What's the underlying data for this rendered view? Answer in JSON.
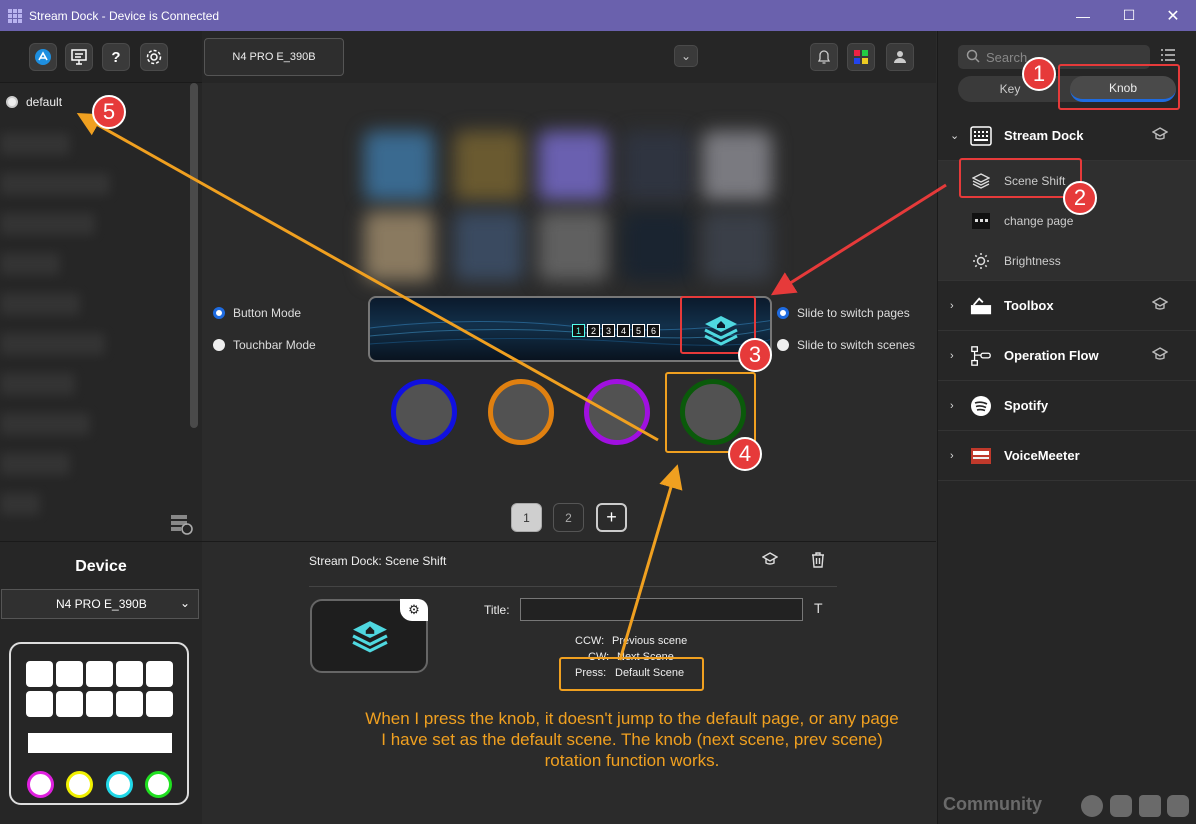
{
  "window": {
    "title": "Stream Dock - Device is Connected",
    "controls": [
      "minimize-icon",
      "maximize-icon",
      "close-icon"
    ]
  },
  "left_toolbar": {
    "buttons": [
      "app-store-icon",
      "presentation-icon",
      "help-icon",
      "gear-icon"
    ],
    "help_glyph": "?"
  },
  "profiles": {
    "items": [
      {
        "label": "default",
        "selected": false
      }
    ]
  },
  "device_panel": {
    "title": "Device",
    "selected_device": "N4 PRO E_390B",
    "knob_colors": [
      "#e020e0",
      "#f0f000",
      "#20d8e8",
      "#20e020"
    ]
  },
  "center_top": {
    "device_tab": "N4 PRO E_390B",
    "icons": [
      "chevron-down-icon",
      "bell-icon",
      "grid-icon",
      "user-icon"
    ]
  },
  "modes": {
    "left": [
      {
        "label": "Button Mode",
        "selected": true
      },
      {
        "label": "Touchbar Mode",
        "selected": false
      }
    ],
    "right": [
      {
        "label": "Slide to switch pages",
        "selected": true
      },
      {
        "label": "Slide to switch scenes",
        "selected": false
      }
    ]
  },
  "touchbar": {
    "pages": [
      "1",
      "2",
      "3",
      "4",
      "5",
      "6"
    ],
    "current_page": "1"
  },
  "knobs": {
    "colors": [
      "#1010e0",
      "#e08010",
      "#a010e0",
      "#0a5a0a"
    ]
  },
  "pagination": {
    "pages": [
      "1",
      "2"
    ],
    "current": "1",
    "add_label": "+"
  },
  "properties": {
    "header": "Stream Dock: Scene Shift",
    "title_label": "Title:",
    "title_value": "",
    "text_tool": "T",
    "ccw_label": "CCW:",
    "ccw_value": "Previous scene",
    "cw_label": "CW:",
    "cw_value": "Next Scene",
    "press_label": "Press:",
    "press_value": "Default Scene"
  },
  "annotation": {
    "note": "When I press the knob, it doesn't jump to the default page, or any page I have set as the default scene. The knob (next scene, prev scene) rotation function works.",
    "badges": [
      "1",
      "2",
      "3",
      "4",
      "5"
    ]
  },
  "right_panel": {
    "search_placeholder": "Search",
    "segments": [
      "Key",
      "Knob"
    ],
    "active_segment": "Knob",
    "categories": [
      {
        "label": "Stream Dock",
        "expanded": true,
        "actions": [
          {
            "label": "Scene Shift",
            "icon": "layers-icon"
          },
          {
            "label": "change page",
            "icon": "page-icon"
          },
          {
            "label": "Brightness",
            "icon": "sun-icon"
          }
        ]
      },
      {
        "label": "Toolbox",
        "expanded": false
      },
      {
        "label": "Operation Flow",
        "expanded": false
      },
      {
        "label": "Spotify",
        "expanded": false
      },
      {
        "label": "VoiceMeeter",
        "expanded": false
      }
    ],
    "community_label": "Community",
    "social_icons": [
      "reddit-icon",
      "discord-icon",
      "chat-icon",
      "hand-icon"
    ]
  },
  "colors": {
    "titlebar": "#6a61ad",
    "accent_blue": "#1e6be0",
    "callout_red": "#e63a3a",
    "callout_orange": "#f0a020",
    "touchbar_icon": "#5fe0e0"
  }
}
